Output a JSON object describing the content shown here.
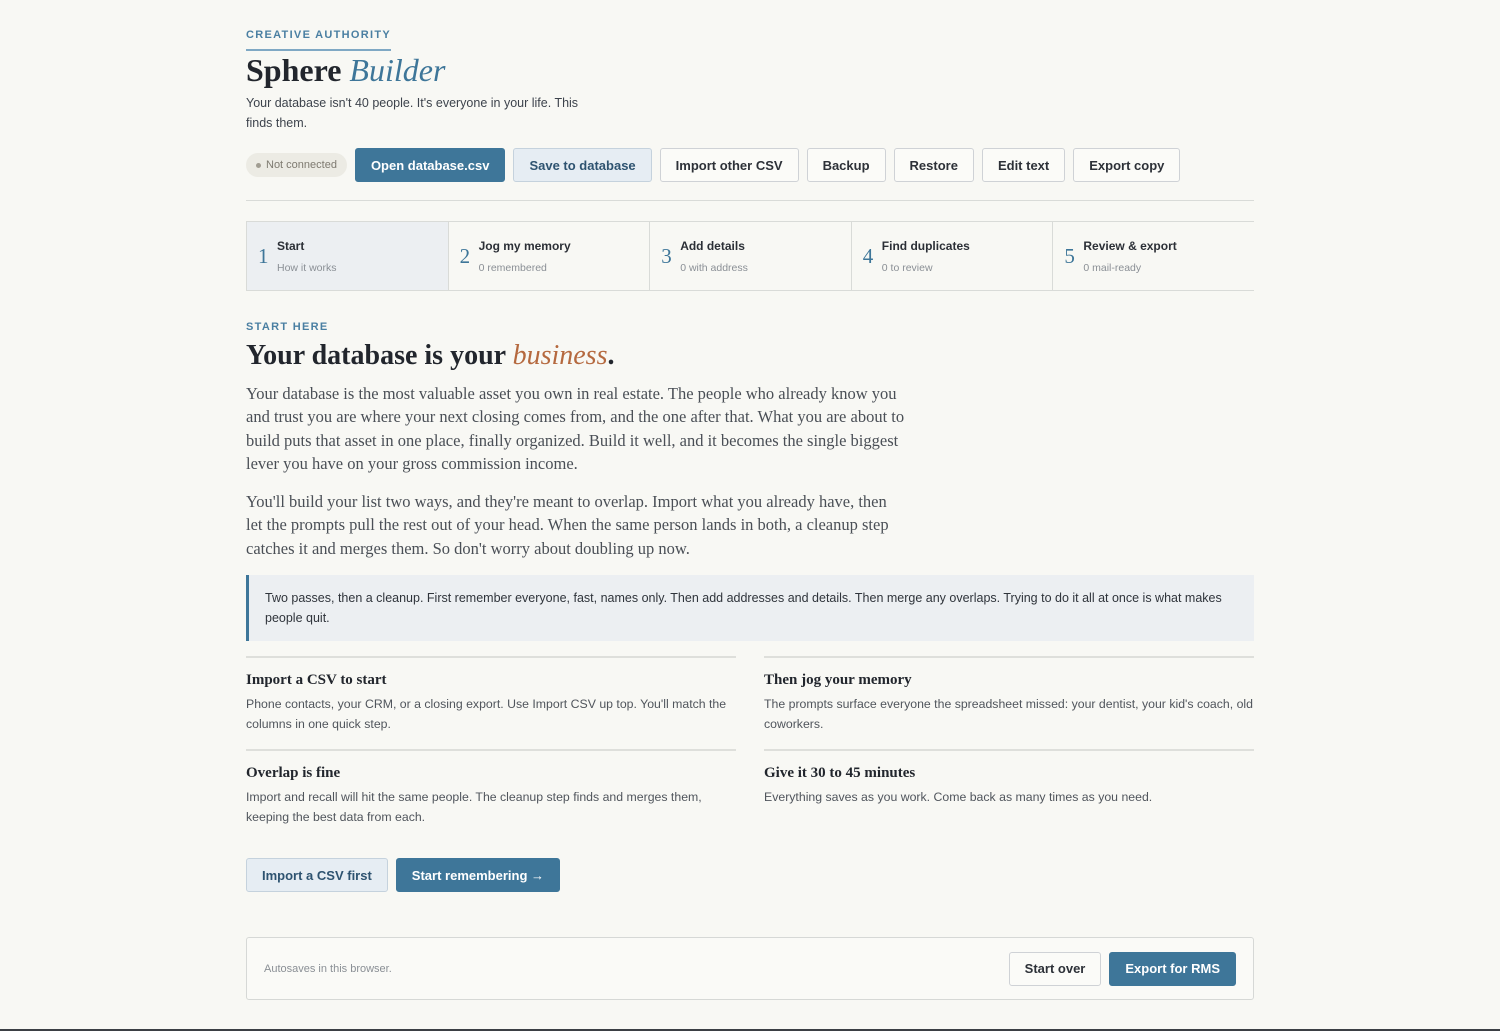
{
  "header": {
    "eyebrow": "CREATIVE AUTHORITY",
    "title_plain": "Sphere",
    "title_accent": "Builder",
    "subtitle": "Your database isn't 40 people. It's everyone in your life. This finds them."
  },
  "toolbar": {
    "status": "Not connected",
    "open_label": "Open database.csv",
    "save_label": "Save to database",
    "import_label": "Import other CSV",
    "backup_label": "Backup",
    "restore_label": "Restore",
    "edit_label": "Edit text",
    "export_label": "Export copy"
  },
  "steps": [
    {
      "num": "1",
      "label": "Start",
      "sub": "How it works"
    },
    {
      "num": "2",
      "label": "Jog my memory",
      "sub": "0 remembered"
    },
    {
      "num": "3",
      "label": "Add details",
      "sub": "0 with address"
    },
    {
      "num": "4",
      "label": "Find duplicates",
      "sub": "0 to review"
    },
    {
      "num": "5",
      "label": "Review & export",
      "sub": "0 mail-ready"
    }
  ],
  "main": {
    "eyebrow": "START HERE",
    "headline_plain": "Your database is your",
    "headline_accent": "business",
    "headline_end": ".",
    "para1": "Your database is the most valuable asset you own in real estate. The people who already know you and trust you are where your next closing comes from, and the one after that. What you are about to build puts that asset in one place, finally organized. Build it well, and it becomes the single biggest lever you have on your gross commission income.",
    "para2": "You'll build your list two ways, and they're meant to overlap. Import what you already have, then let the prompts pull the rest out of your head. When the same person lands in both, a cleanup step catches it and merges them. So don't worry about doubling up now.",
    "callout": "Two passes, then a cleanup. First remember everyone, fast, names only. Then add addresses and details. Then merge any overlaps. Trying to do it all at once is what makes people quit."
  },
  "tips": [
    {
      "title": "Import a CSV to start",
      "text": "Phone contacts, your CRM, or a closing export. Use Import CSV up top. You'll match the columns in one quick step."
    },
    {
      "title": "Then jog your memory",
      "text": "The prompts surface everyone the spreadsheet missed: your dentist, your kid's coach, old coworkers."
    },
    {
      "title": "Overlap is fine",
      "text": "Import and recall will hit the same people. The cleanup step finds and merges them, keeping the best data from each."
    },
    {
      "title": "Give it 30 to 45 minutes",
      "text": "Everything saves as you work. Come back as many times as you need."
    }
  ],
  "cta": {
    "import_first": "Import a CSV first",
    "start_remembering": "Start remembering →"
  },
  "footer": {
    "note": "Autosaves in this browser.",
    "start_over": "Start over",
    "export_rms": "Export for RMS"
  },
  "colors": {
    "accent_blue": "#3e7699",
    "accent_orange": "#b5693f",
    "background": "#f8f8f4"
  }
}
